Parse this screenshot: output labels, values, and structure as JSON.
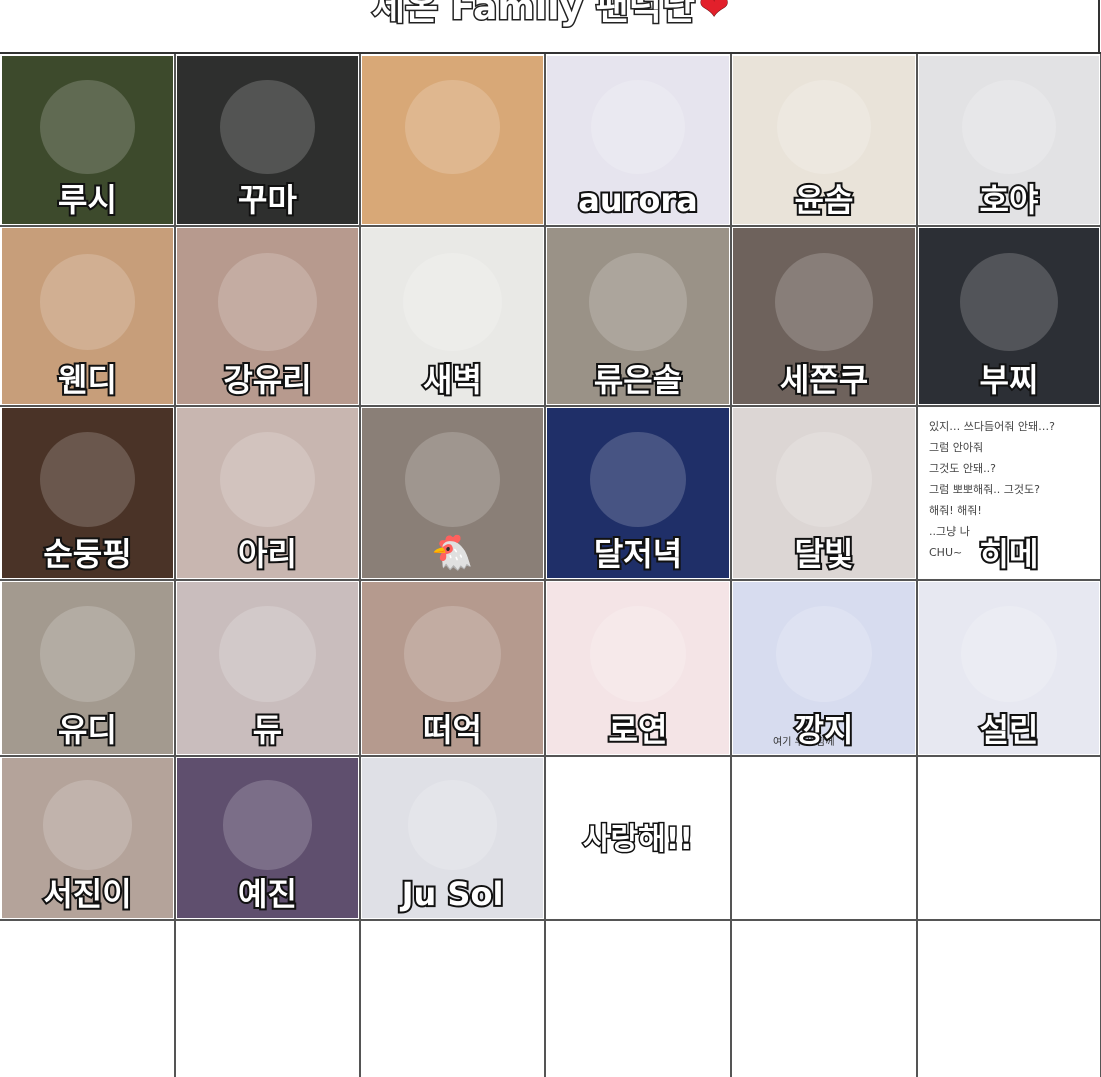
{
  "title": "세온 Family 팬덕단",
  "title_heart": "❤",
  "cells": [
    {
      "name": "루시",
      "bg": "#3d4a2c",
      "icon": "sunflower-photo-icon"
    },
    {
      "name": "꾸마",
      "bg": "#2e2f2e",
      "icon": "black-dog-icon"
    },
    {
      "name": "",
      "bg": "#d8a877",
      "icon": "watermelon-grandpa-icon"
    },
    {
      "name": "aurora",
      "bg": "#e6e4ee",
      "icon": "anime-girl-icon"
    },
    {
      "name": "윤솜",
      "bg": "#e9e3d9",
      "icon": "anime-girl-icon"
    },
    {
      "name": "호야",
      "bg": "#e2e2e4",
      "icon": "anime-girl-icon"
    },
    {
      "name": "웬디",
      "bg": "#c79e7a",
      "icon": "letter-photo-icon"
    },
    {
      "name": "강유리",
      "bg": "#b79a8e",
      "icon": "cat-cap-girl-icon"
    },
    {
      "name": "새벽",
      "bg": "#e9e9e6",
      "icon": "sketch-portrait-icon"
    },
    {
      "name": "류은솔",
      "bg": "#9a9287",
      "icon": "white-dog-icon"
    },
    {
      "name": "세쫀쿠",
      "bg": "#6e625c",
      "icon": "plush-toy-icon"
    },
    {
      "name": "부찌",
      "bg": "#2c2f35",
      "icon": "boy-photo-icon"
    },
    {
      "name": "순둥핑",
      "bg": "#4a3327",
      "icon": "boy-photo-icon"
    },
    {
      "name": "아리",
      "bg": "#c8b6b0",
      "icon": "selfie-girl-icon"
    },
    {
      "name": "",
      "bg": "#8a7f77",
      "icon": "glasses-girl-icon"
    },
    {
      "name": "달저녁",
      "bg": "#1f2f68",
      "icon": "neon-photo-icon"
    },
    {
      "name": "달빛",
      "bg": "#dcd6d4",
      "icon": "anime-girl-icon"
    },
    {
      "name": "히메",
      "bg": "#ffffff",
      "icon": "chat-text-icon"
    },
    {
      "name": "유디",
      "bg": "#a39a8f",
      "icon": "cat-face-icon"
    },
    {
      "name": "듀",
      "bg": "#c9bdbd",
      "icon": "flower-doll-icon"
    },
    {
      "name": "떠억",
      "bg": "#b59a8e",
      "icon": "anime-girl-icon"
    },
    {
      "name": "로연",
      "bg": "#f4e4e6",
      "icon": "anime-girl-icon"
    },
    {
      "name": "깡지",
      "bg": "#d7dcef",
      "icon": "bear-sunglasses-icon"
    },
    {
      "name": "설린",
      "bg": "#e7e8f1",
      "icon": "anime-girl-icon"
    },
    {
      "name": "서진이",
      "bg": "#b4a39a",
      "icon": "selfie-girl-icon"
    },
    {
      "name": "예진",
      "bg": "#5f4f6e",
      "icon": "anime-girl-icon"
    },
    {
      "name": "Ju Sol",
      "bg": "#dfe0e6",
      "icon": "anime-couple-icon"
    }
  ],
  "chicken_emoji": "🐔",
  "hime_note": [
    "있지… 쓰다듬어줘 안돼…?",
    "그럼 안아줘",
    "그것도 안돼..?",
    "그럼 뽀뽀해줘.. 그것도?",
    "해줘! 해줘!",
    "..그냥 나",
    "CHU~"
  ],
  "love_text": "사랑해!!",
  "bear_caption": "여기 우린 함께"
}
